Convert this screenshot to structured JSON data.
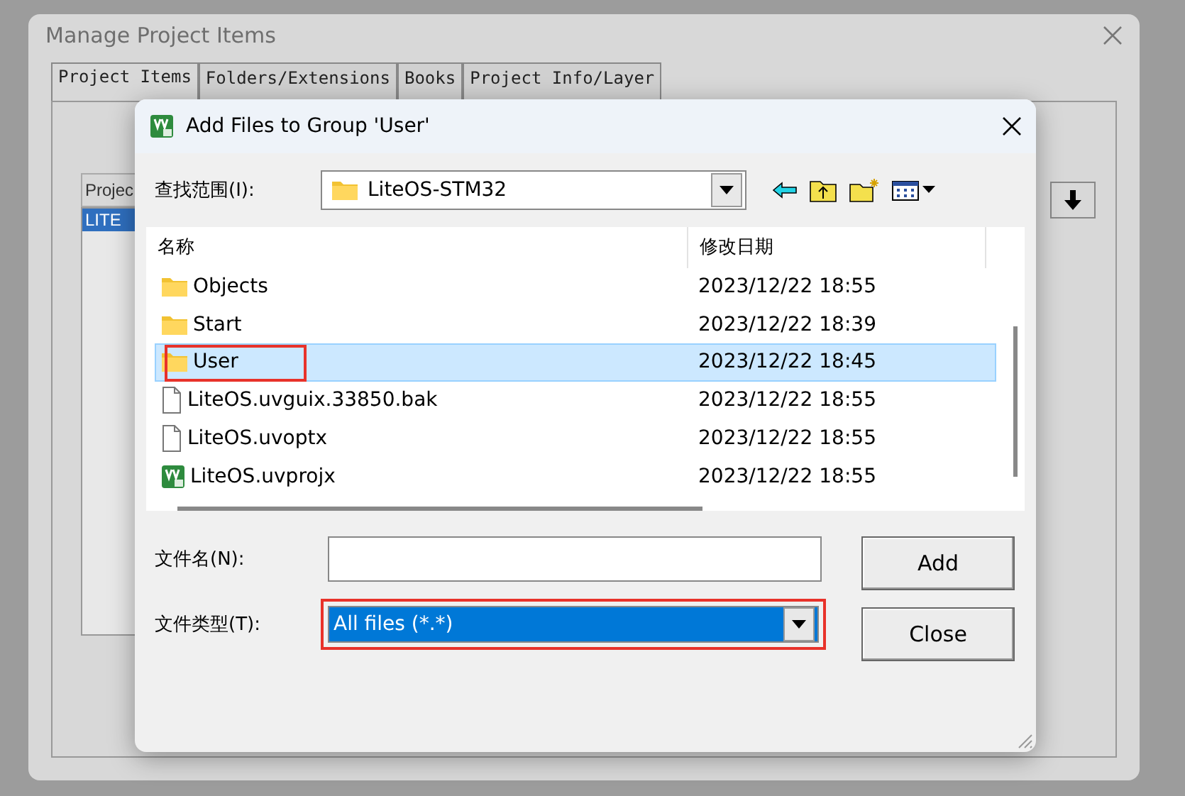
{
  "back_window": {
    "title": "Manage Project Items",
    "tabs": [
      {
        "label": "Project Items",
        "selected": true
      },
      {
        "label": "Folders/Extensions",
        "selected": false
      },
      {
        "label": "Books",
        "selected": false
      },
      {
        "label": "Project Info/Layer",
        "selected": false
      }
    ],
    "list_header": "Projec",
    "list_items": [
      {
        "label": "LITE",
        "selected": true
      }
    ]
  },
  "dialog": {
    "title": "Add Files to Group 'User'",
    "look_in": {
      "label": "查找范围(I):",
      "value": "LiteOS-STM32"
    },
    "columns": [
      "名称",
      "修改日期"
    ],
    "files": [
      {
        "name": "Objects",
        "date": "2023/12/22 18:55",
        "kind": "folder",
        "selected": false,
        "highlighted": false
      },
      {
        "name": "Start",
        "date": "2023/12/22 18:39",
        "kind": "folder",
        "selected": false,
        "highlighted": false
      },
      {
        "name": "User",
        "date": "2023/12/22 18:45",
        "kind": "folder",
        "selected": true,
        "highlighted": true
      },
      {
        "name": "LiteOS.uvguix.33850.bak",
        "date": "2023/12/22 18:55",
        "kind": "file",
        "selected": false,
        "highlighted": false
      },
      {
        "name": "LiteOS.uvoptx",
        "date": "2023/12/22 18:55",
        "kind": "file",
        "selected": false,
        "highlighted": false
      },
      {
        "name": "LiteOS.uvprojx",
        "date": "2023/12/22 18:55",
        "kind": "project",
        "selected": false,
        "highlighted": false
      }
    ],
    "file_name": {
      "label": "文件名(N):"
    },
    "file_type": {
      "label": "文件类型(T):",
      "value": "All files (*.*)",
      "highlighted": true
    },
    "buttons": [
      "Add",
      "Close"
    ]
  }
}
